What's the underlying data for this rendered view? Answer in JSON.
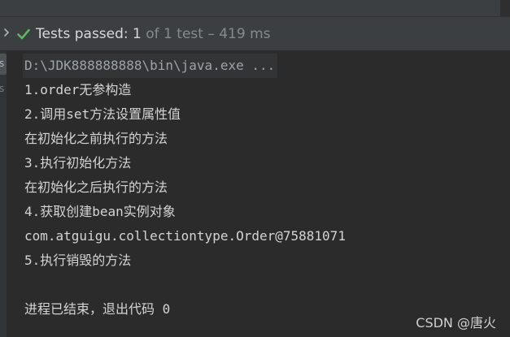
{
  "test_status": {
    "passed_label": "Tests passed: 1",
    "rest_label": " of 1 test – 419 ms"
  },
  "gutter": {
    "tab_label": "s",
    "second_label": "s"
  },
  "console": {
    "command": "D:\\JDK888888888\\bin\\java.exe ...",
    "lines": [
      "1.order无参构造",
      "2.调用set方法设置属性值",
      "在初始化之前执行的方法",
      "3.执行初始化方法",
      "在初始化之后执行的方法",
      "4.获取创建bean实例对象",
      "com.atguigu.collectiontype.Order@75881071",
      "5.执行销毁的方法",
      "",
      "进程已结束，退出代码 0"
    ]
  },
  "watermark": "CSDN @唐火",
  "colors": {
    "background": "#2b2b2b",
    "header": "#3c3f41",
    "pass_green": "#5fb65f",
    "text": "#d4d4d4"
  }
}
